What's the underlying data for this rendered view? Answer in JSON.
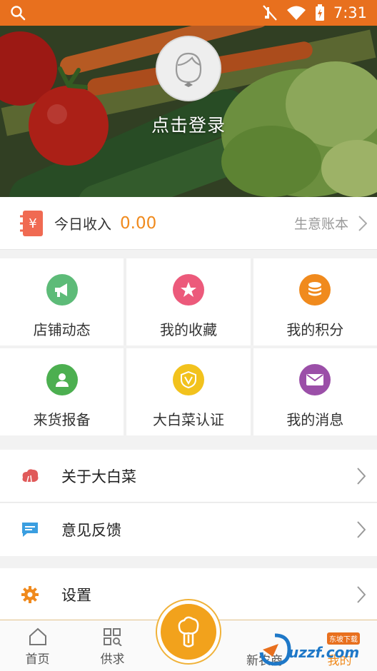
{
  "status_bar": {
    "time": "7:31",
    "icons": [
      "search-icon",
      "mute-icon",
      "wifi-icon",
      "battery-charging-icon"
    ]
  },
  "profile": {
    "avatar_icon": "user-avatar-icon",
    "login_label": "点击登录"
  },
  "income": {
    "icon": "income-ledger-icon",
    "label": "今日收入",
    "value": "0.00",
    "ledger_label": "生意账本"
  },
  "grid": [
    {
      "label": "店铺动态",
      "icon": "megaphone-icon",
      "color": "#5dbb78"
    },
    {
      "label": "我的收藏",
      "icon": "star-icon",
      "color": "#ec5a7b"
    },
    {
      "label": "我的积分",
      "icon": "coins-icon",
      "color": "#f08a1d"
    },
    {
      "label": "来货报备",
      "icon": "person-report-icon",
      "color": "#4caf50"
    },
    {
      "label": "大白菜认证",
      "icon": "shield-v-icon",
      "color": "#f2c21d"
    },
    {
      "label": "我的消息",
      "icon": "envelope-icon",
      "color": "#9b4fa8"
    }
  ],
  "list": [
    {
      "label": "关于大白菜",
      "icon": "cabbage-icon",
      "color": "#e05a5a"
    },
    {
      "label": "意见反馈",
      "icon": "chat-icon",
      "color": "#3a9ee0"
    },
    {
      "label": "设置",
      "icon": "gear-icon",
      "color": "#f08a1d"
    }
  ],
  "bottom_nav": [
    {
      "label": "首页",
      "icon": "home-icon"
    },
    {
      "label": "供求",
      "icon": "grid-search-icon"
    },
    {
      "label": "",
      "icon": "cabbage-center-icon"
    },
    {
      "label": "新农商",
      "icon": ""
    },
    {
      "label": "我的",
      "icon": "",
      "active": true
    }
  ],
  "colors": {
    "accent": "#f08a1d",
    "status_bar": "#e8701e"
  },
  "watermark": {
    "text": "uzzf.com",
    "badge": "东坡下载"
  }
}
